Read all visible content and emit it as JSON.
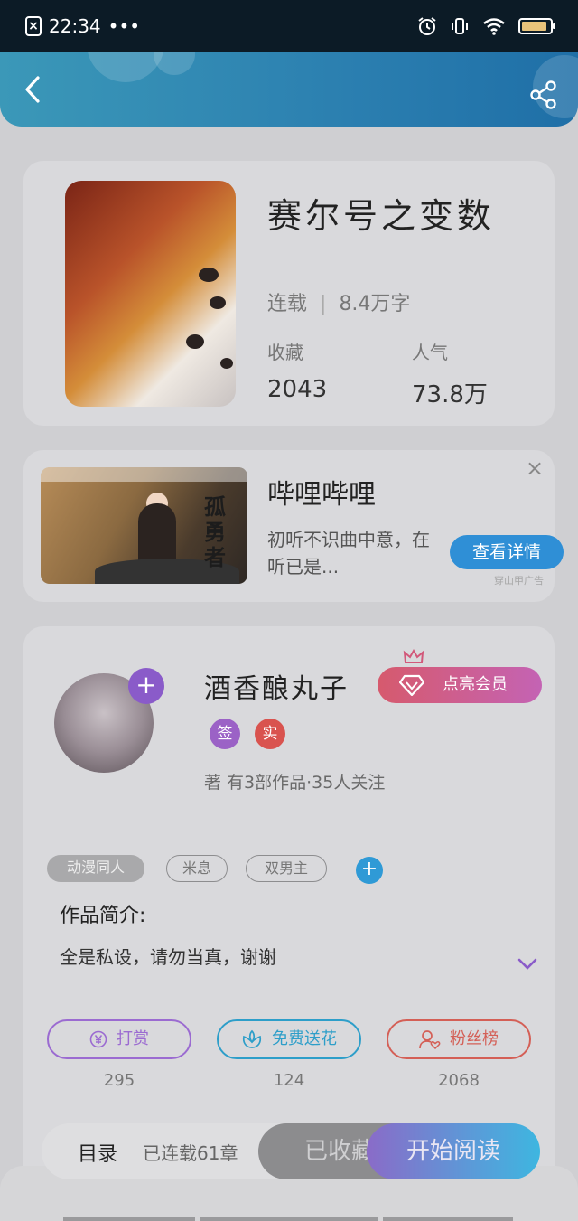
{
  "status_bar": {
    "time": "22:34",
    "dots": "•••",
    "x_icon": "×"
  },
  "header": {
    "back_icon": "chevron-left-icon",
    "share_icon": "share-icon"
  },
  "book": {
    "title": "赛尔号之变数",
    "status": "连载",
    "word_count": "8.4万字",
    "favorites_label": "收藏",
    "favorites_value": "2043",
    "popularity_label": "人气",
    "popularity_value": "73.8万"
  },
  "ad": {
    "name": "哔哩哔哩",
    "description": "初听不识曲中意，在听已是...",
    "button_label": "查看详情",
    "close": "×",
    "tag": "穿山甲广告",
    "thumb_text": "孤勇者"
  },
  "author": {
    "name": "酒香酿丸子",
    "plus": "+",
    "vip_label": "点亮会员",
    "badges": [
      "签",
      "实"
    ],
    "meta": "著 有3部作品·35人关注"
  },
  "tags": [
    "动漫同人",
    "米息",
    "双男主"
  ],
  "tag_add": "+",
  "intro": {
    "heading": "作品简介:",
    "text": "全是私设，请勿当真，谢谢"
  },
  "actions": [
    {
      "label": "打赏",
      "count": "295"
    },
    {
      "label": "免费送花",
      "count": "124"
    },
    {
      "label": "粉丝榜",
      "count": "2068"
    }
  ],
  "bottom_bar": {
    "toc_label": "目录",
    "toc_status": "已连载61章",
    "favorite_label": "已收藏",
    "read_label": "开始阅读"
  },
  "colors": {
    "accent_purple": "#8a5bc9",
    "accent_blue": "#2f8fd6",
    "action_purple": "#9b6bd1",
    "action_teal": "#2d9ec9",
    "action_red": "#d45f56"
  }
}
